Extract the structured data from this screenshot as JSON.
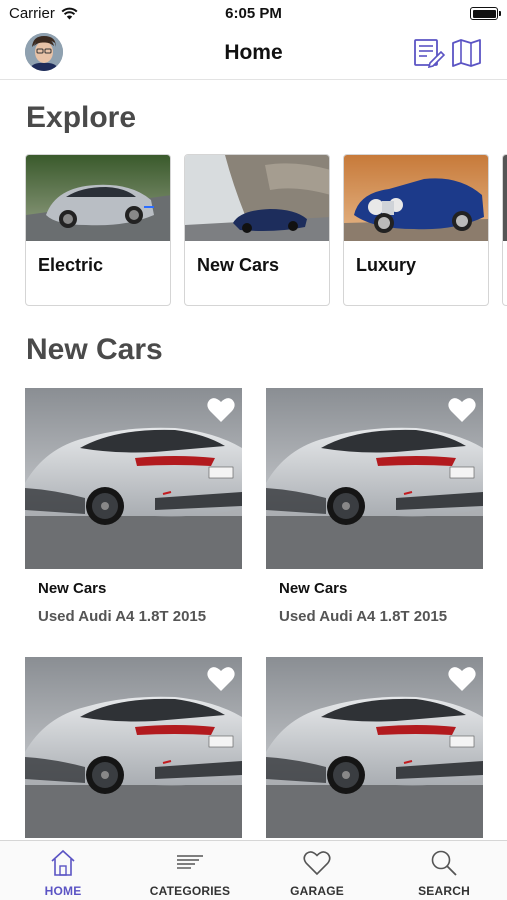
{
  "status_bar": {
    "carrier": "Carrier",
    "time": "6:05 PM"
  },
  "nav": {
    "title": "Home"
  },
  "explore": {
    "title": "Explore",
    "cards": [
      {
        "label": "Electric"
      },
      {
        "label": "New Cars"
      },
      {
        "label": "Luxury"
      }
    ]
  },
  "new_cars": {
    "title": "New Cars",
    "items": [
      {
        "title": "New Cars",
        "subtitle": "Used Audi A4 1.8T 2015"
      },
      {
        "title": "New Cars",
        "subtitle": "Used Audi A4 1.8T 2015"
      },
      {
        "title": "",
        "subtitle": ""
      },
      {
        "title": "",
        "subtitle": ""
      }
    ]
  },
  "tabs": [
    {
      "label": "HOME",
      "icon": "home-icon",
      "active": true
    },
    {
      "label": "CATEGORIES",
      "icon": "list-icon",
      "active": false
    },
    {
      "label": "GARAGE",
      "icon": "heart-icon",
      "active": false
    },
    {
      "label": "SEARCH",
      "icon": "search-icon",
      "active": false
    }
  ],
  "colors": {
    "accent": "#5b54c4",
    "section_title": "#4a4a4a"
  }
}
